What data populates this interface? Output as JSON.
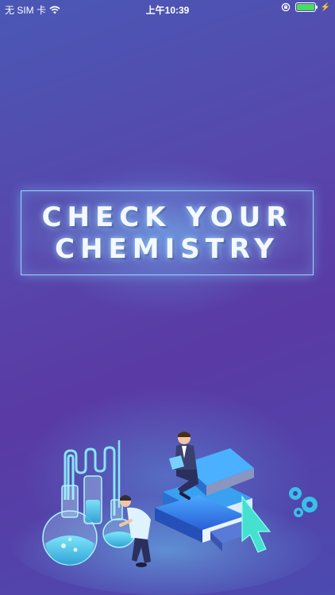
{
  "status_bar": {
    "carrier": "无 SIM 卡",
    "time": "上午10:39",
    "icons": [
      "wifi-icon",
      "lock-rotation-icon",
      "battery-icon",
      "charging-icon"
    ],
    "battery_level": 1.0
  },
  "splash": {
    "title_line_1": "CHECK YOUR",
    "title_line_2": "CHEMISTRY"
  },
  "colors": {
    "background_top": "#4a58b5",
    "background_bottom": "#5a3aa4",
    "frame": "#a0e6ff",
    "battery": "#4cd964"
  }
}
